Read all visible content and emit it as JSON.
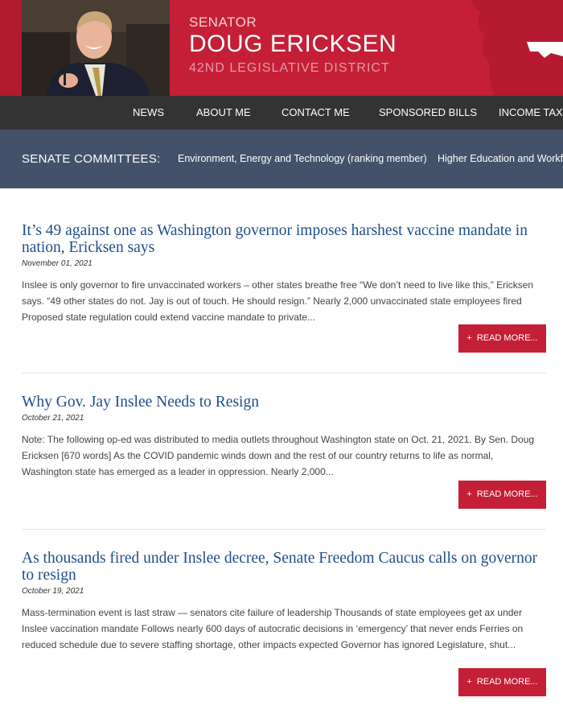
{
  "header": {
    "senator": "SENATOR",
    "name": "DOUG ERICKSEN",
    "district": "42ND LEGISLATIVE DISTRICT",
    "brand_color": "#c41f36"
  },
  "nav": {
    "items": [
      {
        "label": "NEWS"
      },
      {
        "label": "ABOUT ME"
      },
      {
        "label": "CONTACT ME"
      },
      {
        "label": "SPONSORED BILLS"
      },
      {
        "label": "INCOME TAX II"
      }
    ]
  },
  "committees": {
    "label": "SENATE COMMITTEES:",
    "items": [
      {
        "label": "Environment, Energy and Technology (ranking member)"
      },
      {
        "label": "Higher Education and Workfo"
      }
    ]
  },
  "articles": [
    {
      "title": "It’s 49 against one as Washington governor imposes harshest vaccine mandate in nation, Ericksen says",
      "date": "November 01, 2021",
      "excerpt": "Inslee is only governor to fire unvaccinated workers – other states breathe free “We don’t need to live like this,” Ericksen says. “49 other states do not. Jay is out of touch. He should resign.” Nearly 2,000 unvaccinated state employees fired Proposed state regulation could extend vaccine mandate to private...",
      "read_more": "READ MORE..."
    },
    {
      "title": "Why Gov. Jay Inslee Needs to Resign",
      "date": "October 21, 2021",
      "excerpt": "Note: The following op-ed was distributed to media outlets throughout Washington state on Oct. 21, 2021. By Sen. Doug Ericksen [670 words] As the COVID pandemic winds down and the rest of our country returns to life as normal, Washington state has emerged as a leader in oppression. Nearly 2,000...",
      "read_more": "READ MORE..."
    },
    {
      "title": "As thousands fired under Inslee decree, Senate Freedom Caucus calls on governor to resign",
      "date": "October 19, 2021",
      "excerpt": "Mass-termination event is last straw — senators cite failure of leadership Thousands of state employees get ax under Inslee vaccination mandate Follows nearly 600 days of autocratic decisions in ‘emergency’ that never ends Ferries on reduced schedule due to severe staffing shortage, other impacts expected Governor has ignored Legislature, shut...",
      "read_more": "READ MORE..."
    }
  ],
  "read_more_icon": "+"
}
